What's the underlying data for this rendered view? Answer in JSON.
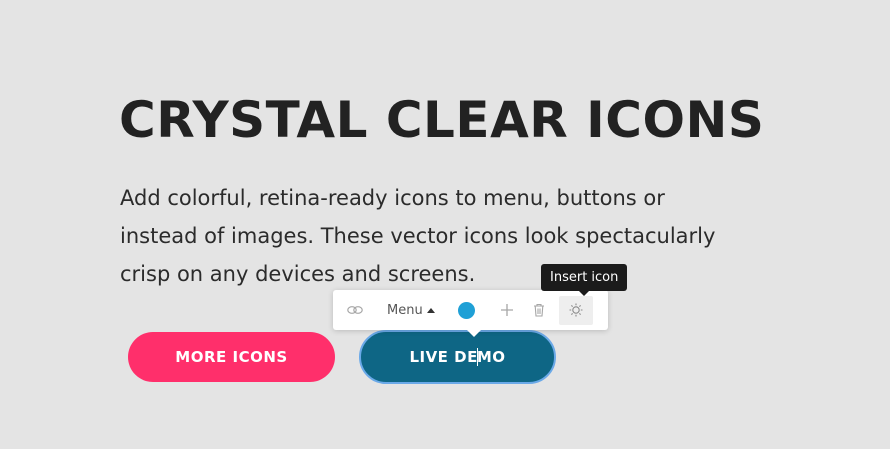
{
  "hero": {
    "title": "CRYSTAL CLEAR ICONS",
    "text_lines": [
      "Add colorful, retina-ready icons to menu, buttons or",
      "instead of images. These vector icons look spectacularly",
      "crisp on any devices and screens."
    ]
  },
  "buttons": {
    "more_label": "MORE ICONS",
    "live_label_before": "LIVE DE",
    "live_label_after": "MO"
  },
  "toolbar": {
    "menu_label": "Menu",
    "color_value": "#1fa0d6",
    "icons": [
      "link-icon",
      "plus-icon",
      "trash-icon",
      "sun-icon"
    ]
  },
  "tooltip": {
    "text": "Insert icon"
  },
  "colors": {
    "background": "#e4e4e4",
    "more_button": "#ff2f6b",
    "live_button": "#0e6685",
    "live_button_outline": "#6aa9e8"
  }
}
